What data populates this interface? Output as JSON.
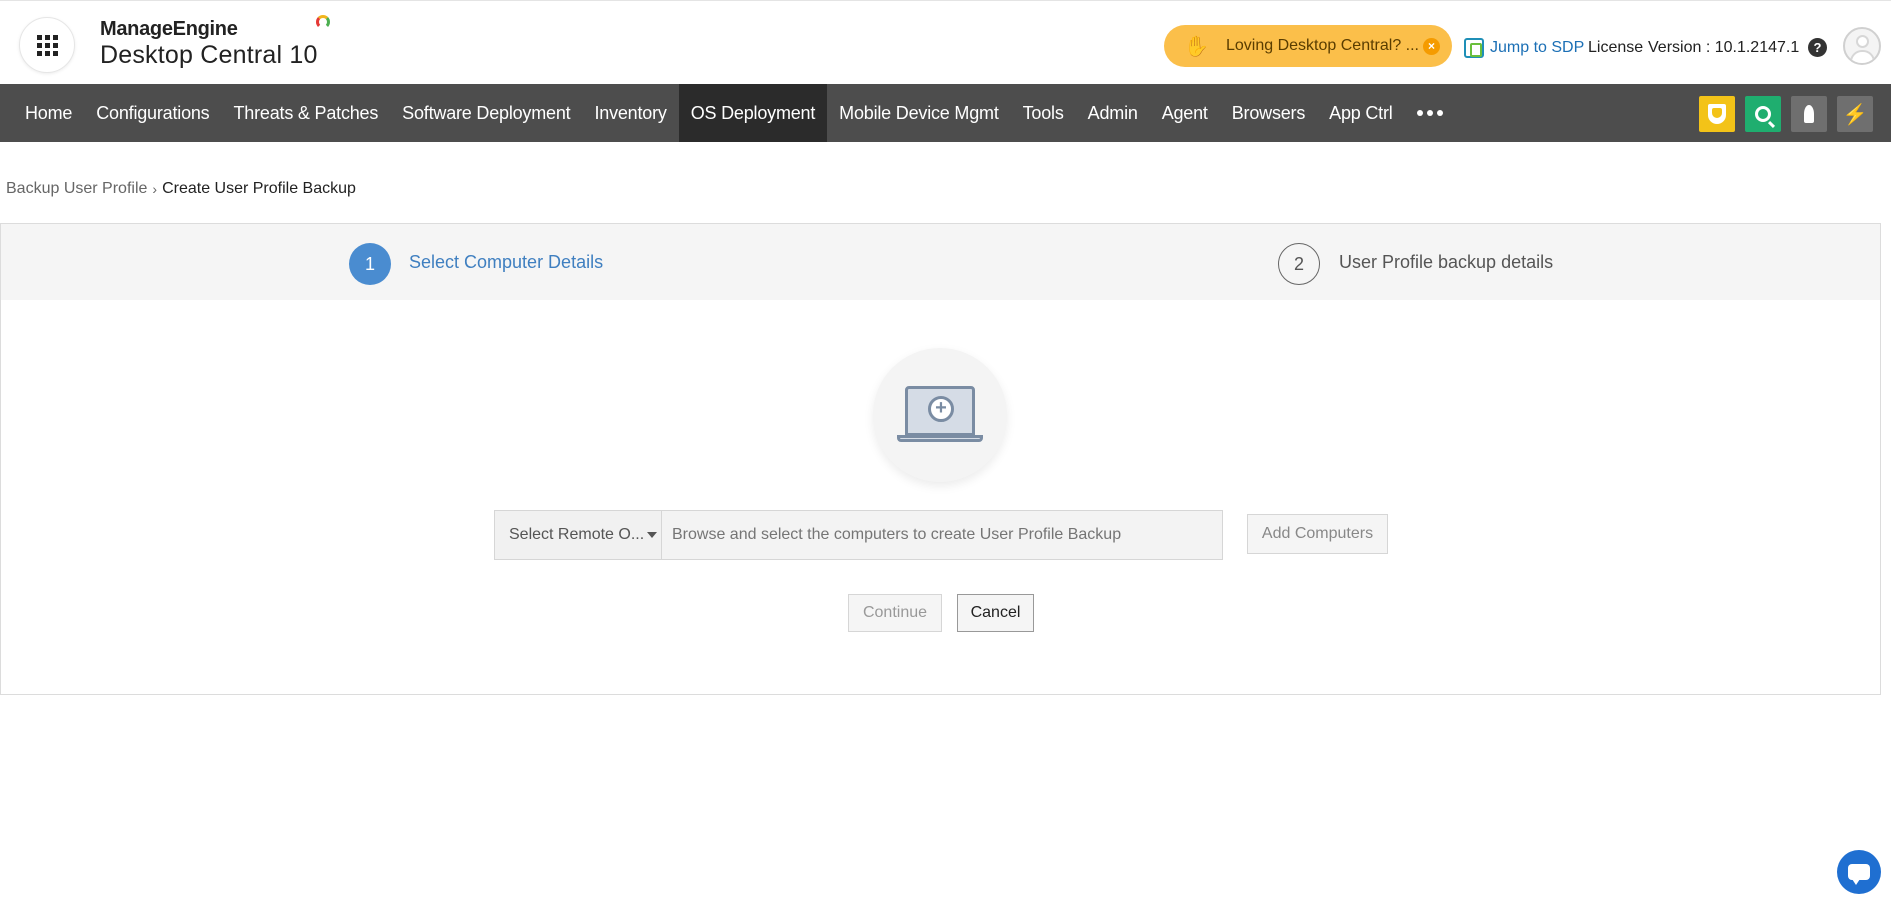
{
  "header": {
    "brand_top": "ManageEngine",
    "brand_bottom": "Desktop Central 10",
    "promo_text": "Loving Desktop Central? ...",
    "promo_close": "×",
    "jump_link": "Jump to SDP",
    "license": "License",
    "version": "Version : 10.1.2147.1",
    "help": "?"
  },
  "nav": {
    "items": [
      {
        "label": "Home"
      },
      {
        "label": "Configurations"
      },
      {
        "label": "Threats & Patches"
      },
      {
        "label": "Software Deployment"
      },
      {
        "label": "Inventory"
      },
      {
        "label": "OS Deployment",
        "active": true
      },
      {
        "label": "Mobile Device Mgmt"
      },
      {
        "label": "Tools"
      },
      {
        "label": "Admin"
      },
      {
        "label": "Agent"
      },
      {
        "label": "Browsers"
      },
      {
        "label": "App Ctrl"
      }
    ],
    "bolt": "⚡"
  },
  "breadcrumb": {
    "parent": "Backup User Profile",
    "separator": "›",
    "current": "Create User Profile Backup"
  },
  "wizard": {
    "step1_number": "1",
    "step1_label": "Select Computer Details",
    "step2_number": "2",
    "step2_label": "User Profile backup details",
    "plus": "+",
    "dropdown_value": "Select Remote O...",
    "input_placeholder": "Browse and select the computers to create User Profile Backup",
    "add_button": "Add Computers",
    "continue_button": "Continue",
    "cancel_button": "Cancel"
  },
  "colors": {
    "nav_bg": "#4d4d4d",
    "nav_active": "#2b2b2b",
    "step_active": "#4a8cd0",
    "promo_bg": "#fbbf4a"
  }
}
